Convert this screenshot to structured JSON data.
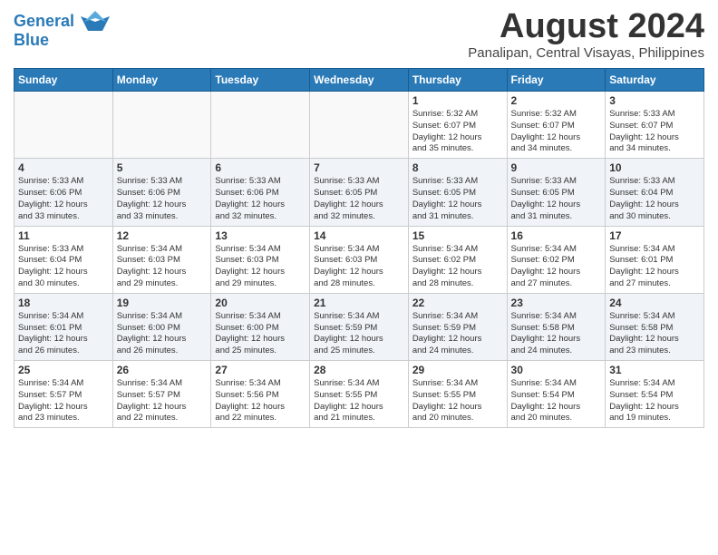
{
  "header": {
    "logo_line1": "General",
    "logo_line2": "Blue",
    "month_title": "August 2024",
    "location": "Panalipan, Central Visayas, Philippines"
  },
  "weekdays": [
    "Sunday",
    "Monday",
    "Tuesday",
    "Wednesday",
    "Thursday",
    "Friday",
    "Saturday"
  ],
  "weeks": [
    [
      {
        "day": "",
        "info": ""
      },
      {
        "day": "",
        "info": ""
      },
      {
        "day": "",
        "info": ""
      },
      {
        "day": "",
        "info": ""
      },
      {
        "day": "1",
        "info": "Sunrise: 5:32 AM\nSunset: 6:07 PM\nDaylight: 12 hours\nand 35 minutes."
      },
      {
        "day": "2",
        "info": "Sunrise: 5:32 AM\nSunset: 6:07 PM\nDaylight: 12 hours\nand 34 minutes."
      },
      {
        "day": "3",
        "info": "Sunrise: 5:33 AM\nSunset: 6:07 PM\nDaylight: 12 hours\nand 34 minutes."
      }
    ],
    [
      {
        "day": "4",
        "info": "Sunrise: 5:33 AM\nSunset: 6:06 PM\nDaylight: 12 hours\nand 33 minutes."
      },
      {
        "day": "5",
        "info": "Sunrise: 5:33 AM\nSunset: 6:06 PM\nDaylight: 12 hours\nand 33 minutes."
      },
      {
        "day": "6",
        "info": "Sunrise: 5:33 AM\nSunset: 6:06 PM\nDaylight: 12 hours\nand 32 minutes."
      },
      {
        "day": "7",
        "info": "Sunrise: 5:33 AM\nSunset: 6:05 PM\nDaylight: 12 hours\nand 32 minutes."
      },
      {
        "day": "8",
        "info": "Sunrise: 5:33 AM\nSunset: 6:05 PM\nDaylight: 12 hours\nand 31 minutes."
      },
      {
        "day": "9",
        "info": "Sunrise: 5:33 AM\nSunset: 6:05 PM\nDaylight: 12 hours\nand 31 minutes."
      },
      {
        "day": "10",
        "info": "Sunrise: 5:33 AM\nSunset: 6:04 PM\nDaylight: 12 hours\nand 30 minutes."
      }
    ],
    [
      {
        "day": "11",
        "info": "Sunrise: 5:33 AM\nSunset: 6:04 PM\nDaylight: 12 hours\nand 30 minutes."
      },
      {
        "day": "12",
        "info": "Sunrise: 5:34 AM\nSunset: 6:03 PM\nDaylight: 12 hours\nand 29 minutes."
      },
      {
        "day": "13",
        "info": "Sunrise: 5:34 AM\nSunset: 6:03 PM\nDaylight: 12 hours\nand 29 minutes."
      },
      {
        "day": "14",
        "info": "Sunrise: 5:34 AM\nSunset: 6:03 PM\nDaylight: 12 hours\nand 28 minutes."
      },
      {
        "day": "15",
        "info": "Sunrise: 5:34 AM\nSunset: 6:02 PM\nDaylight: 12 hours\nand 28 minutes."
      },
      {
        "day": "16",
        "info": "Sunrise: 5:34 AM\nSunset: 6:02 PM\nDaylight: 12 hours\nand 27 minutes."
      },
      {
        "day": "17",
        "info": "Sunrise: 5:34 AM\nSunset: 6:01 PM\nDaylight: 12 hours\nand 27 minutes."
      }
    ],
    [
      {
        "day": "18",
        "info": "Sunrise: 5:34 AM\nSunset: 6:01 PM\nDaylight: 12 hours\nand 26 minutes."
      },
      {
        "day": "19",
        "info": "Sunrise: 5:34 AM\nSunset: 6:00 PM\nDaylight: 12 hours\nand 26 minutes."
      },
      {
        "day": "20",
        "info": "Sunrise: 5:34 AM\nSunset: 6:00 PM\nDaylight: 12 hours\nand 25 minutes."
      },
      {
        "day": "21",
        "info": "Sunrise: 5:34 AM\nSunset: 5:59 PM\nDaylight: 12 hours\nand 25 minutes."
      },
      {
        "day": "22",
        "info": "Sunrise: 5:34 AM\nSunset: 5:59 PM\nDaylight: 12 hours\nand 24 minutes."
      },
      {
        "day": "23",
        "info": "Sunrise: 5:34 AM\nSunset: 5:58 PM\nDaylight: 12 hours\nand 24 minutes."
      },
      {
        "day": "24",
        "info": "Sunrise: 5:34 AM\nSunset: 5:58 PM\nDaylight: 12 hours\nand 23 minutes."
      }
    ],
    [
      {
        "day": "25",
        "info": "Sunrise: 5:34 AM\nSunset: 5:57 PM\nDaylight: 12 hours\nand 23 minutes."
      },
      {
        "day": "26",
        "info": "Sunrise: 5:34 AM\nSunset: 5:57 PM\nDaylight: 12 hours\nand 22 minutes."
      },
      {
        "day": "27",
        "info": "Sunrise: 5:34 AM\nSunset: 5:56 PM\nDaylight: 12 hours\nand 22 minutes."
      },
      {
        "day": "28",
        "info": "Sunrise: 5:34 AM\nSunset: 5:55 PM\nDaylight: 12 hours\nand 21 minutes."
      },
      {
        "day": "29",
        "info": "Sunrise: 5:34 AM\nSunset: 5:55 PM\nDaylight: 12 hours\nand 20 minutes."
      },
      {
        "day": "30",
        "info": "Sunrise: 5:34 AM\nSunset: 5:54 PM\nDaylight: 12 hours\nand 20 minutes."
      },
      {
        "day": "31",
        "info": "Sunrise: 5:34 AM\nSunset: 5:54 PM\nDaylight: 12 hours\nand 19 minutes."
      }
    ]
  ]
}
